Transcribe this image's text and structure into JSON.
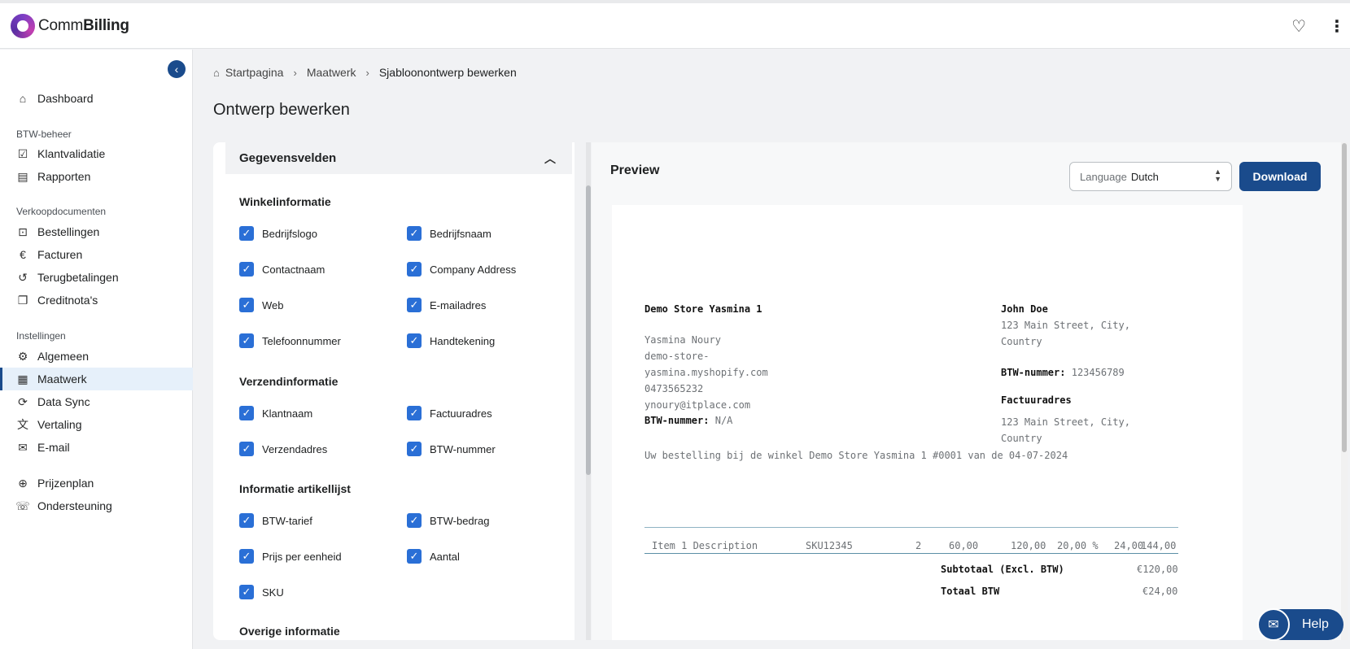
{
  "app": {
    "brand_prefix": "Comm",
    "brand_suffix": "Billing"
  },
  "header": {
    "heart_icon": "heart-icon",
    "menu_icon": "kebab-menu-icon"
  },
  "sidebar": {
    "items": [
      {
        "label": "Dashboard",
        "icon": "home-icon"
      },
      {
        "label": "Klantvalidatie",
        "icon": "validation-icon"
      },
      {
        "label": "Rapporten",
        "icon": "report-icon"
      },
      {
        "label": "Bestellingen",
        "icon": "inbox-icon"
      },
      {
        "label": "Facturen",
        "icon": "euro-invoice-icon"
      },
      {
        "label": "Terugbetalingen",
        "icon": "refund-icon"
      },
      {
        "label": "Creditnota's",
        "icon": "credit-note-icon"
      },
      {
        "label": "Algemeen",
        "icon": "gear-icon"
      },
      {
        "label": "Maatwerk",
        "icon": "custom-doc-icon",
        "active": true
      },
      {
        "label": "Data Sync",
        "icon": "sync-icon"
      },
      {
        "label": "Vertaling",
        "icon": "translate-icon"
      },
      {
        "label": "E-mail",
        "icon": "email-settings-icon"
      },
      {
        "label": "Prijzenplan",
        "icon": "euro-circle-icon"
      },
      {
        "label": "Ondersteuning",
        "icon": "chat-icon"
      }
    ],
    "sections": {
      "btw": "BTW-beheer",
      "verkoop": "Verkoopdocumenten",
      "instellingen": "Instellingen"
    }
  },
  "breadcrumb": {
    "home": "Startpagina",
    "middle": "Maatwerk",
    "current": "Sjabloonontwerp bewerken"
  },
  "page_title": "Ontwerp bewerken",
  "fields_panel": {
    "section_title": "Gegevensvelden",
    "groups": {
      "winkel": {
        "title": "Winkelinformatie",
        "items": [
          "Bedrijfslogo",
          "Bedrijfsnaam",
          "Contactnaam",
          "Company Address",
          "Web",
          "E-mailadres",
          "Telefoonnummer",
          "Handtekening"
        ]
      },
      "verzend": {
        "title": "Verzendinformatie",
        "items": [
          "Klantnaam",
          "Factuuradres",
          "Verzendadres",
          "BTW-nummer"
        ]
      },
      "artikel": {
        "title": "Informatie artikellijst",
        "items": [
          "BTW-tarief",
          "BTW-bedrag",
          "Prijs per eenheid",
          "Aantal",
          "SKU"
        ]
      },
      "overig": {
        "title": "Overige informatie"
      }
    }
  },
  "preview": {
    "title": "Preview",
    "language_label": "Language",
    "language_value": "Dutch",
    "download_label": "Download",
    "invoice": {
      "store_name": "Demo Store Yasmina 1",
      "contact": "Yasmina Noury",
      "web_line1": "demo-store-",
      "web_line2": "yasmina.myshopify.com",
      "phone": "0473565232",
      "email": "ynoury@itplace.com",
      "vat_label": "BTW-nummer:",
      "store_vat": "N/A",
      "customer_name": "John Doe",
      "customer_addr_line1": "123 Main Street, City,",
      "customer_addr_line2": "Country",
      "customer_vat": "123456789",
      "billing_title": "Factuuradres",
      "billing_line1": "123 Main Street, City,",
      "billing_line2": "Country",
      "order_line": "Uw bestelling bij de winkel Demo Store Yasmina 1 #0001 van de 04-07-2024",
      "row": {
        "description": "Item 1 Description",
        "sku": "SKU12345",
        "qty": "2",
        "unit_price": "60,00",
        "subtotal": "120,00",
        "vat_rate": "20,00 %",
        "vat_amount": "24,00",
        "total": "144,00"
      },
      "subtotal_label": "Subtotaal (Excl. BTW)",
      "subtotal_value": "€120,00",
      "vat_total_label": "Totaal BTW",
      "vat_total_value": "€24,00"
    }
  },
  "help": {
    "label": "Help",
    "icon": "chat-bubbles-icon"
  }
}
